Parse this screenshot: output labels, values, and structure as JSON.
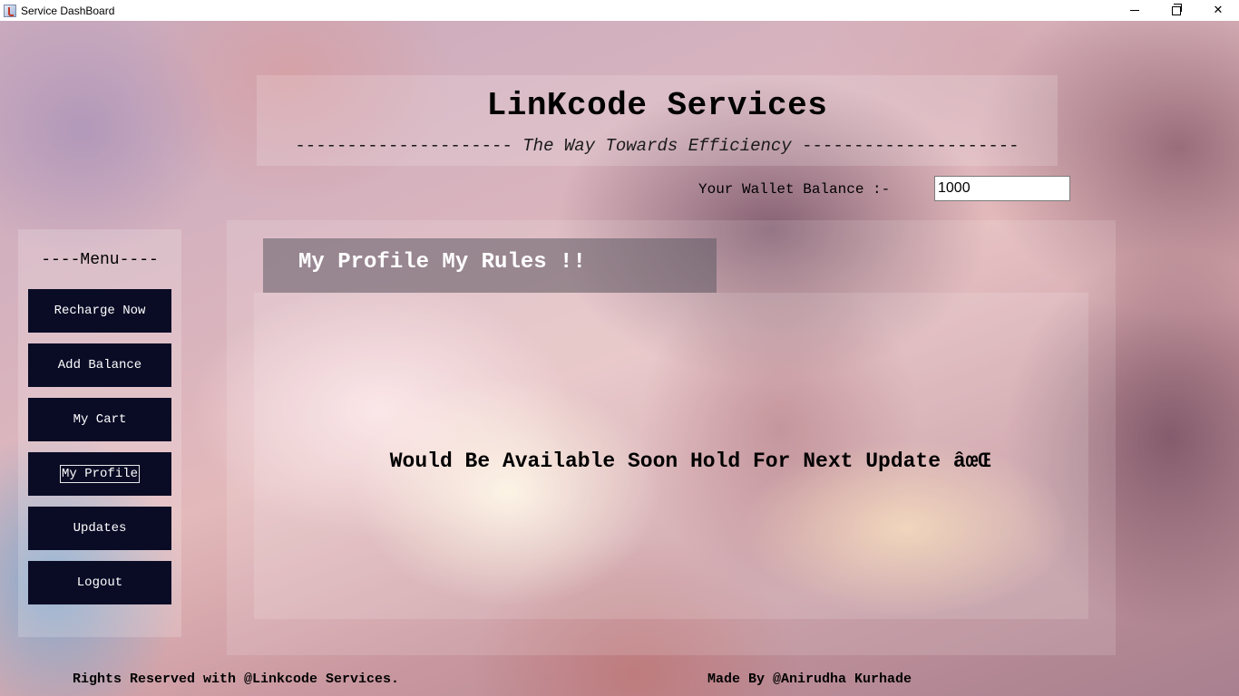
{
  "window": {
    "title": "Service DashBoard",
    "controls": {
      "minimize": "minimize",
      "restore": "restore",
      "close": "✕"
    }
  },
  "header": {
    "app_title": "LinKcode Services",
    "tagline_dashes_left": "---------------------",
    "tagline_text": "The Way Towards Efficiency",
    "tagline_dashes_right": "---------------------"
  },
  "wallet": {
    "label": "Your Wallet Balance :-",
    "value": "1000"
  },
  "menu": {
    "heading": "----Menu----",
    "items": [
      {
        "label": "Recharge Now"
      },
      {
        "label": "Add Balance"
      },
      {
        "label": "My Cart"
      },
      {
        "label": "My Profile"
      },
      {
        "label": "Updates"
      },
      {
        "label": "Logout"
      }
    ],
    "focused_item": "My Profile"
  },
  "main": {
    "section_heading": "My Profile My Rules !!",
    "notice": "Would Be Available Soon Hold For Next Update âœŒ"
  },
  "footer": {
    "rights": "Rights Reserved with @Linkcode Services.",
    "credit": "Made By @Anirudha Kurhade"
  }
}
